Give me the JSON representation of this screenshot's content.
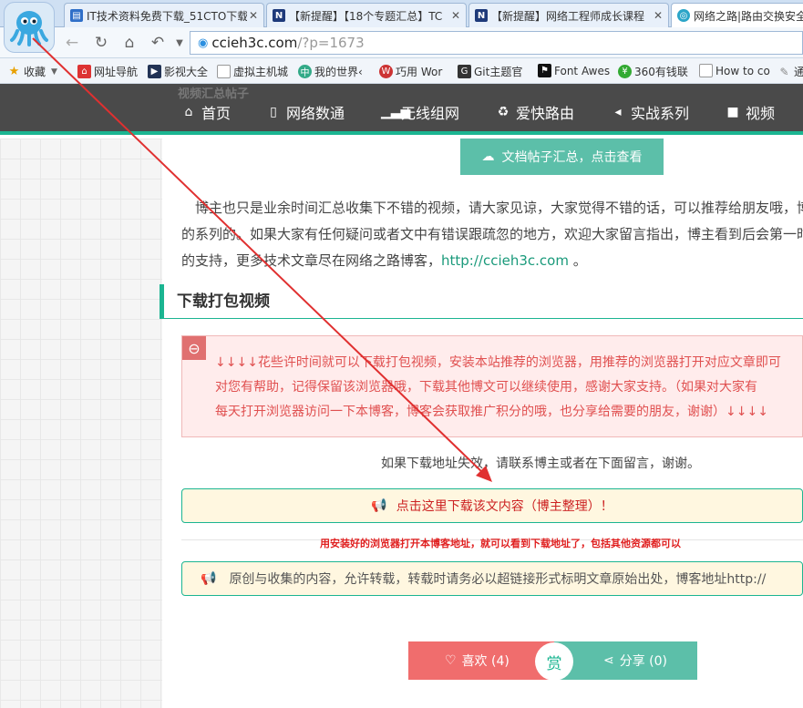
{
  "browser": {
    "tabs": [
      {
        "title": "IT技术资料免费下载_51CTO下载",
        "active": false,
        "fav": "blue"
      },
      {
        "title": "【新提醒】【18个专题汇总】TC",
        "active": false,
        "fav": "navy"
      },
      {
        "title": "【新提醒】网络工程师成长课程",
        "active": false,
        "fav": "navy"
      },
      {
        "title": "网络之路|路由交换安全",
        "active": true,
        "fav": "teal"
      }
    ],
    "address": {
      "host": "ccieh3c.com",
      "path": "/?p=1673"
    },
    "bookmarks": [
      {
        "label": "收藏",
        "icon": "star-icon"
      },
      {
        "label": "网址导航",
        "icon": "home-icon"
      },
      {
        "label": "影视大全",
        "icon": "film-icon"
      },
      {
        "label": "虚拟主机城",
        "icon": "page-icon"
      },
      {
        "label": "我的世界‹",
        "icon": "globe-icon"
      },
      {
        "label": "巧用 Wor",
        "icon": "word-icon"
      },
      {
        "label": "Git主题官",
        "icon": "git-icon"
      },
      {
        "label": "Font Awes",
        "icon": "flag-icon"
      },
      {
        "label": "360有钱联",
        "icon": "coin-icon"
      },
      {
        "label": "How to co",
        "icon": "page-icon"
      },
      {
        "label": "通",
        "icon": "link-icon"
      }
    ]
  },
  "site": {
    "ghost_heading": "视频汇总帖子",
    "nav": [
      {
        "label": "首页",
        "icon": "home-icon"
      },
      {
        "label": "网络数通",
        "icon": "file-icon"
      },
      {
        "label": "无线组网",
        "icon": "signal-icon"
      },
      {
        "label": "爱快路由",
        "icon": "recycle-icon"
      },
      {
        "label": "实战系列",
        "icon": "share-icon"
      },
      {
        "label": "视频",
        "icon": "video-icon"
      }
    ]
  },
  "content": {
    "doc_button": "文档帖子汇总，点击查看",
    "para_lines": [
      "　博主也只是业余时间汇总收集下不错的视频，请大家见谅，大家觉得不错的话，可以推荐给朋友哦，博",
      "的系列的。如果大家有任何疑问或者文中有错误跟疏忽的地方，欢迎大家留言指出，博主看到后会第一时",
      "的支持，更多技术文章尽在网络之路博客，"
    ],
    "para_link": "http://ccieh3c.com",
    "para_end": " 。",
    "section_title": "下载打包视频",
    "alert_lines": [
      "↓↓↓↓花些许时间就可以下载打包视频，安装本站推荐的浏览器，用推荐的浏览器打开对应文章即可",
      "对您有帮助，记得保留该浏览器哦，下载其他博文可以继续使用，感谢大家支持。（如果对大家有",
      "每天打开浏览器访问一下本博客，博客会获取推广积分的哦，也分享给需要的朋友，谢谢）↓↓↓↓"
    ],
    "center_note": "如果下载地址失效，请联系博主或者在下面留言，谢谢。",
    "download_label": "点击这里下载该文内容（博主整理）！",
    "red_note": "用安装好的浏览器打开本博客地址，就可以看到下载地址了，包括其他资源都可以",
    "notice": "原创与收集的内容，允许转载，转载时请务必以超链接形式标明文章原始出处，博客地址http://",
    "like_label": "喜欢 (4)",
    "reward_label": "赏",
    "share_label": "分享 (0)"
  },
  "colors": {
    "accent": "#1bb591",
    "nav_bg": "#4a4a4a",
    "alert_bg": "#ffecec",
    "like": "#f06d6d",
    "share": "#5cbfa9",
    "arrow": "#e03030"
  }
}
